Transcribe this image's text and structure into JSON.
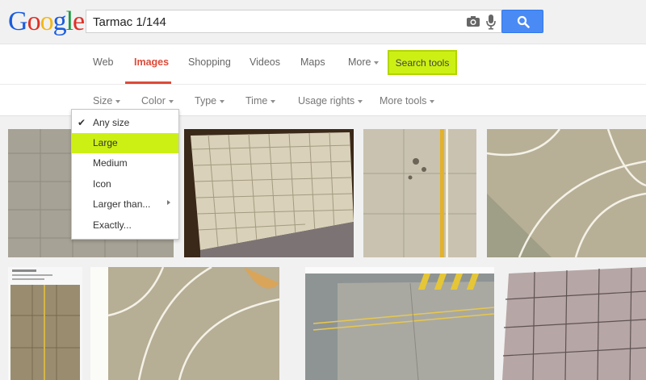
{
  "logo": {
    "letters": [
      "G",
      "o",
      "o",
      "g",
      "l",
      "e"
    ],
    "colors": [
      "#1a5ddd",
      "#dd3127",
      "#f2b818",
      "#1a5ddd",
      "#1a9c45",
      "#dd3127"
    ]
  },
  "search": {
    "value": "Tarmac 1/144",
    "camera_icon": "camera-icon",
    "mic_icon": "mic-icon",
    "button_icon": "search-icon"
  },
  "nav": {
    "web": "Web",
    "images": "Images",
    "shopping": "Shopping",
    "videos": "Videos",
    "maps": "Maps",
    "more": "More",
    "search_tools": "Search tools"
  },
  "tools": {
    "size": "Size",
    "color": "Color",
    "type": "Type",
    "time": "Time",
    "usage": "Usage rights",
    "more_tools": "More tools"
  },
  "size_menu": {
    "items": [
      "Any size",
      "Large",
      "Medium",
      "Icon",
      "Larger than...",
      "Exactly..."
    ],
    "checked": "Any size",
    "highlighted": "Large"
  },
  "colors": {
    "accent_red": "#dd4b39",
    "highlight": "#cdf014",
    "button_blue": "#4a8af4"
  }
}
